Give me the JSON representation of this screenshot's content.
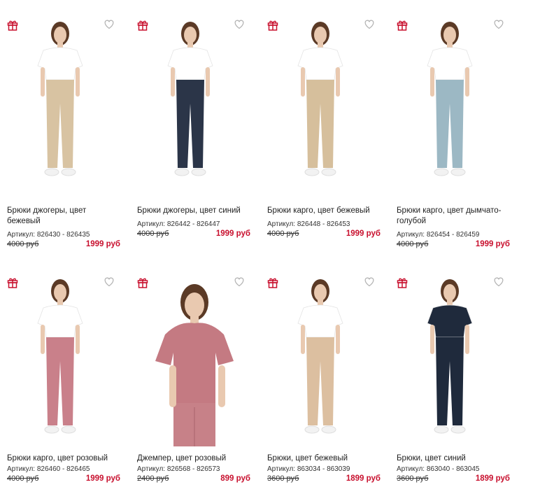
{
  "products": [
    {
      "title": "Брюки джогеры, цвет бежевый",
      "sku_label": "Артикул:",
      "sku": "826430 - 826435",
      "old_price": "4000 руб",
      "new_price": "1999 руб",
      "top_color": "#ffffff",
      "bottom_color": "#d8c3a2",
      "item": "pants"
    },
    {
      "title": "Брюки джогеры, цвет синий",
      "sku_label": "Артикул:",
      "sku": "826442 - 826447",
      "old_price": "4000 руб",
      "new_price": "1999 руб",
      "top_color": "#ffffff",
      "bottom_color": "#2b3548",
      "item": "pants"
    },
    {
      "title": "Брюки карго, цвет бежевый",
      "sku_label": "Артикул:",
      "sku": "826448 - 826453",
      "old_price": "4000 руб",
      "new_price": "1999 руб",
      "top_color": "#ffffff",
      "bottom_color": "#d6bf9c",
      "item": "pants"
    },
    {
      "title": "Брюки карго, цвет дымчато-голубой",
      "sku_label": "Артикул:",
      "sku": "826454 - 826459",
      "old_price": "4000 руб",
      "new_price": "1999 руб",
      "top_color": "#ffffff",
      "bottom_color": "#9cb8c4",
      "item": "pants"
    },
    {
      "title": "Брюки карго, цвет розовый",
      "sku_label": "Артикул:",
      "sku": "826460 - 826465",
      "old_price": "4000 руб",
      "new_price": "1999 руб",
      "top_color": "#ffffff",
      "bottom_color": "#c9808a",
      "item": "pants"
    },
    {
      "title": "Джемпер, цвет розовый",
      "sku_label": "Артикул:",
      "sku": "826568 - 826573",
      "old_price": "2400 руб",
      "new_price": "899 руб",
      "top_color": "#c47a82",
      "bottom_color": "#c47a82",
      "item": "jumper"
    },
    {
      "title": "Брюки, цвет бежевый",
      "sku_label": "Артикул:",
      "sku": "863034 - 863039",
      "old_price": "3600 руб",
      "new_price": "1899 руб",
      "top_color": "#ffffff",
      "bottom_color": "#dcbfa0",
      "item": "pants"
    },
    {
      "title": "Брюки, цвет синий",
      "sku_label": "Артикул:",
      "sku": "863040 - 863045",
      "old_price": "3600 руб",
      "new_price": "1899 руб",
      "top_color": "#1f2a3c",
      "bottom_color": "#1f2a3c",
      "item": "pants"
    }
  ],
  "colors": {
    "price_red": "#c8102e",
    "gift_red": "#c8102e",
    "heart_gray": "#b0b0b0"
  },
  "icons": {
    "gift": "gift-icon",
    "favorite": "heart-icon"
  }
}
